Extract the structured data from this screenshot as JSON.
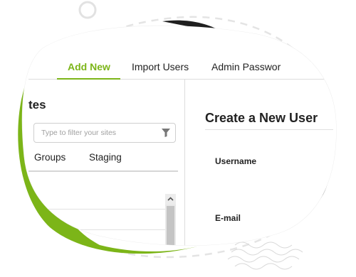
{
  "tabs": [
    {
      "label": "Add New",
      "active": true
    },
    {
      "label": "Import Users",
      "active": false
    },
    {
      "label": "Admin Passwor",
      "active": false
    }
  ],
  "sites_panel": {
    "title": "tes",
    "filter_placeholder": "Type to filter your sites",
    "sub_tabs": [
      "Groups",
      "Staging"
    ]
  },
  "form": {
    "title": "Create a New User",
    "fields": [
      {
        "label": "Username"
      },
      {
        "label": "E-mail"
      }
    ]
  },
  "colors": {
    "accent": "#7cb518",
    "dark_blob": "#1f1f1f"
  }
}
